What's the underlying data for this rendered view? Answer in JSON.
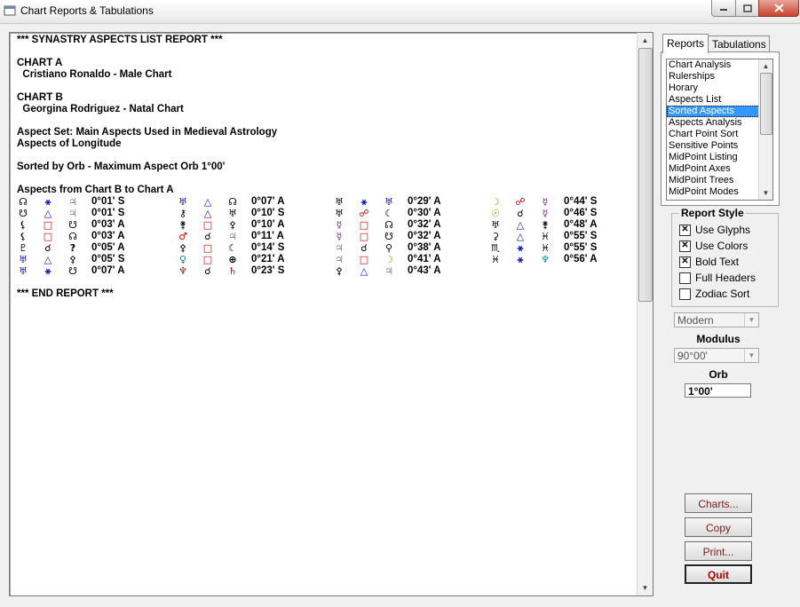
{
  "window": {
    "title": "Chart Reports & Tabulations"
  },
  "report": {
    "lines": [
      "*** SYNASTRY ASPECTS LIST REPORT ***",
      "",
      "CHART A",
      "  Cristiano Ronaldo - Male Chart",
      "",
      "CHART B",
      "  Georgina Rodriguez - Natal Chart",
      "",
      "Aspect Set: Main Aspects Used in Medieval Astrology",
      "Aspects of Longitude",
      "",
      "Sorted by Orb - Maximum Aspect Orb 1°00'",
      "",
      "Aspects from Chart B to Chart A"
    ],
    "columns": [
      [
        {
          "p1": "☊",
          "p1c": "#000",
          "asp": "⚹",
          "ac": "#1010c0",
          "p2": "♃",
          "p2c": "#888",
          "orb": "0°01' S"
        },
        {
          "p1": "☋",
          "p1c": "#000",
          "asp": "△",
          "ac": "#1010c0",
          "p2": "♃",
          "p2c": "#888",
          "orb": "0°01' S"
        },
        {
          "p1": "⚸",
          "p1c": "#000",
          "asp": "□",
          "ac": "#d00000",
          "p2": "☋",
          "p2c": "#000",
          "orb": "0°03' A"
        },
        {
          "p1": "⚸",
          "p1c": "#000",
          "asp": "□",
          "ac": "#d00000",
          "p2": "☊",
          "p2c": "#000",
          "orb": "0°03' A"
        },
        {
          "p1": "♇",
          "p1c": "#000",
          "asp": "☌",
          "ac": "#000",
          "p2": "?",
          "p2c": "#000",
          "orb": "0°05' A"
        },
        {
          "p1": "♅",
          "p1c": "#1010c0",
          "asp": "△",
          "ac": "#1010c0",
          "p2": "⚴",
          "p2c": "#000",
          "orb": "0°05' S"
        },
        {
          "p1": "♅",
          "p1c": "#1010c0",
          "asp": "⚹",
          "ac": "#1010c0",
          "p2": "☋",
          "p2c": "#000",
          "orb": "0°07' A"
        }
      ],
      [
        {
          "p1": "♅",
          "p1c": "#1010c0",
          "asp": "△",
          "ac": "#1010c0",
          "p2": "☊",
          "p2c": "#000",
          "orb": "0°07' A"
        },
        {
          "p1": "⚷",
          "p1c": "#000",
          "asp": "△",
          "ac": "#1010c0",
          "p2": "♅",
          "p2c": "#000",
          "orb": "0°10' S"
        },
        {
          "p1": "⚵",
          "p1c": "#000",
          "asp": "□",
          "ac": "#d00000",
          "p2": "⚴",
          "p2c": "#000",
          "orb": "0°10' A"
        },
        {
          "p1": "♂",
          "p1c": "#d00000",
          "asp": "☌",
          "ac": "#000",
          "p2": "♃",
          "p2c": "#888",
          "orb": "0°11' A"
        },
        {
          "p1": "⚴",
          "p1c": "#000",
          "asp": "□",
          "ac": "#d00000",
          "p2": "☾",
          "p2c": "#000",
          "orb": "0°14' S"
        },
        {
          "p1": "♀",
          "p1c": "#008888",
          "asp": "□",
          "ac": "#d00000",
          "p2": "⊕",
          "p2c": "#000",
          "orb": "0°21' A"
        },
        {
          "p1": "♆",
          "p1c": "#8a1a1a",
          "asp": "☌",
          "ac": "#000",
          "p2": "♄",
          "p2c": "#8a1a1a",
          "orb": "0°23' S"
        }
      ],
      [
        {
          "p1": "♅",
          "p1c": "#000",
          "asp": "⚹",
          "ac": "#1010c0",
          "p2": "♅",
          "p2c": "#1010c0",
          "orb": "0°29' A"
        },
        {
          "p1": "♅",
          "p1c": "#000",
          "asp": "☍",
          "ac": "#d00000",
          "p2": "☾",
          "p2c": "#000",
          "orb": "0°30' A"
        },
        {
          "p1": "☿",
          "p1c": "#8a2090",
          "asp": "□",
          "ac": "#d00000",
          "p2": "☊",
          "p2c": "#000",
          "orb": "0°32' A"
        },
        {
          "p1": "☿",
          "p1c": "#8a2090",
          "asp": "□",
          "ac": "#d00000",
          "p2": "☋",
          "p2c": "#000",
          "orb": "0°32' A"
        },
        {
          "p1": "♃",
          "p1c": "#888",
          "asp": "☌",
          "ac": "#000",
          "p2": "⚲",
          "p2c": "#000",
          "orb": "0°38' A"
        },
        {
          "p1": "♃",
          "p1c": "#888",
          "asp": "□",
          "ac": "#d00000",
          "p2": "☽",
          "p2c": "#a0a000",
          "orb": "0°41' A"
        },
        {
          "p1": "⚴",
          "p1c": "#000",
          "asp": "△",
          "ac": "#1010c0",
          "p2": "♃",
          "p2c": "#888",
          "orb": "0°43' A"
        }
      ],
      [
        {
          "p1": "☽",
          "p1c": "#a0a000",
          "asp": "☍",
          "ac": "#d00000",
          "p2": "☿",
          "p2c": "#8a2090",
          "orb": "0°44' S"
        },
        {
          "p1": "☉",
          "p1c": "#a0a000",
          "asp": "☌",
          "ac": "#000",
          "p2": "☿",
          "p2c": "#8a2090",
          "orb": "0°46' S"
        },
        {
          "p1": "♅",
          "p1c": "#000",
          "asp": "△",
          "ac": "#1010c0",
          "p2": "⚵",
          "p2c": "#000",
          "orb": "0°48' A"
        },
        {
          "p1": "⚳",
          "p1c": "#000",
          "asp": "△",
          "ac": "#1010c0",
          "p2": "♓",
          "p2c": "#000",
          "orb": "0°55' S"
        },
        {
          "p1": "♏",
          "p1c": "#000",
          "asp": "⚹",
          "ac": "#1010c0",
          "p2": "♓",
          "p2c": "#000",
          "orb": "0°55' S"
        },
        {
          "p1": "♓",
          "p1c": "#000",
          "asp": "⚹",
          "ac": "#1010c0",
          "p2": "♆",
          "p2c": "#008888",
          "orb": "0°56' A"
        }
      ]
    ],
    "end": "*** END REPORT ***"
  },
  "tabs": [
    {
      "label": "Reports",
      "active": true
    },
    {
      "label": "Tabulations",
      "active": false
    }
  ],
  "report_list": {
    "items": [
      "Chart Analysis",
      "Rulerships",
      "Horary",
      "Aspects List",
      "Sorted Aspects",
      "Aspects Analysis",
      "Chart Point Sort",
      "Sensitive Points",
      "MidPoint Listing",
      "MidPoint Axes",
      "MidPoint Trees",
      "MidPoint Modes"
    ],
    "selected": "Sorted Aspects"
  },
  "report_style": {
    "title": "Report Style",
    "options": [
      {
        "label": "Use Glyphs",
        "checked": true
      },
      {
        "label": "Use Colors",
        "checked": true
      },
      {
        "label": "Bold Text",
        "checked": true
      },
      {
        "label": "Full Headers",
        "checked": false
      },
      {
        "label": "Zodiac Sort",
        "checked": false
      }
    ]
  },
  "mode_select": {
    "value": "Modern"
  },
  "modulus": {
    "label": "Modulus",
    "value": "90°00'"
  },
  "orb": {
    "label": "Orb",
    "value": "1°00'"
  },
  "buttons": {
    "charts": "Charts...",
    "copy": "Copy",
    "print": "Print...",
    "quit": "Quit"
  },
  "colors": {
    "selection": "#3399ff",
    "quit_text": "#b00000"
  }
}
